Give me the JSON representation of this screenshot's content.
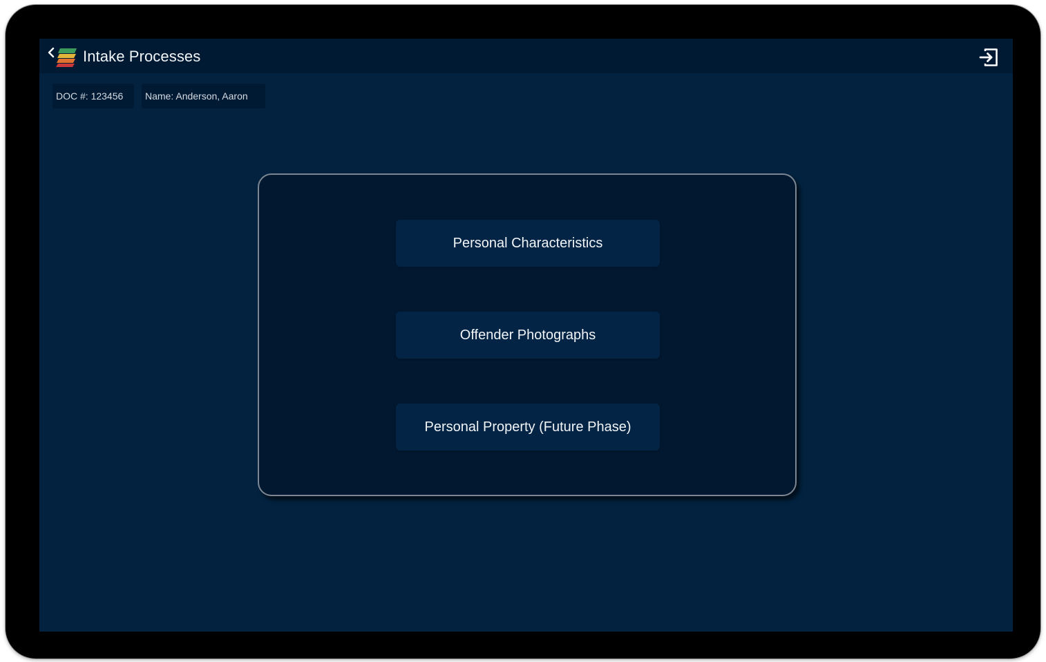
{
  "header": {
    "title": "Intake Processes",
    "back_icon": "chevron-left-icon",
    "logo_icon": "app-logo-icon",
    "logout_icon": "logout-icon"
  },
  "offender": {
    "doc": "DOC #: 123456",
    "name": "Name: Anderson, Aaron"
  },
  "menu": {
    "items": [
      {
        "label": "Personal Characteristics"
      },
      {
        "label": "Offender Photographs"
      },
      {
        "label": "Personal Property (Future Phase)"
      }
    ]
  },
  "colors": {
    "screen_bg": "#02223f",
    "header_bg": "#011a33",
    "panel_bg": "#021830",
    "button_bg": "#032445",
    "panel_border": "#7d8793",
    "text": "#f2f5f8"
  }
}
